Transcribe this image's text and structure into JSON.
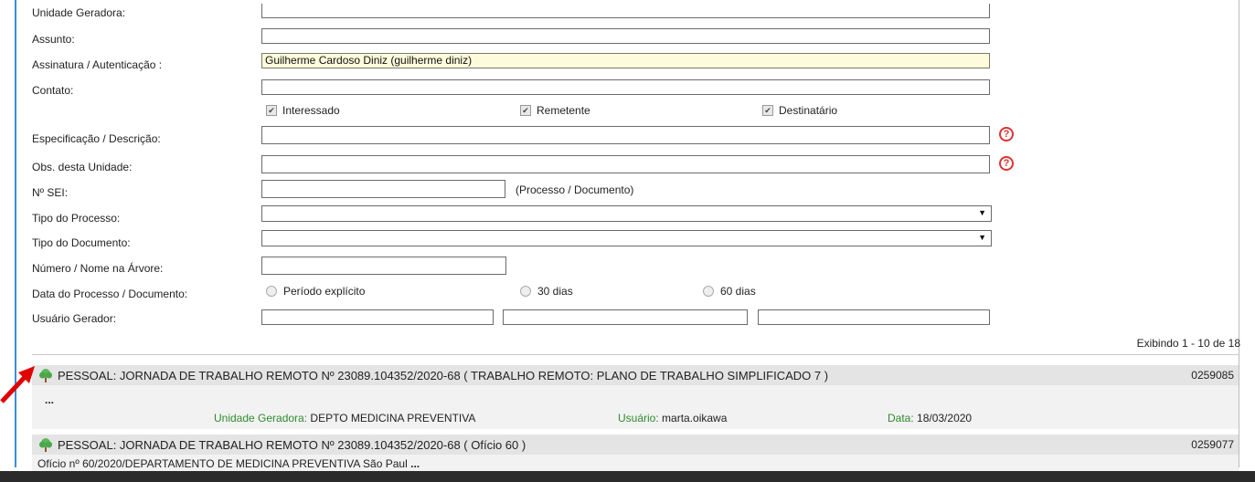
{
  "form": {
    "unidade_geradora_label": "Unidade Geradora:",
    "assunto_label": "Assunto:",
    "assinatura_label": "Assinatura / Autenticação :",
    "assinatura_value": "Guilherme Cardoso Diniz (guilherme diniz)",
    "contato_label": "Contato:",
    "checkbox_interessado": "Interessado",
    "checkbox_remetente": "Remetente",
    "checkbox_destinatario": "Destinatário",
    "especificacao_label": "Especificação / Descrição:",
    "obs_label": "Obs. desta Unidade:",
    "nsei_label": "Nº SEI:",
    "nsei_hint": "(Processo / Documento)",
    "tipo_processo_label": "Tipo do Processo:",
    "tipo_documento_label": "Tipo do Documento:",
    "numero_nome_label": "Número / Nome na Árvore:",
    "data_label": "Data do Processo / Documento:",
    "radio_periodo": "Período explícito",
    "radio_30": "30 dias",
    "radio_60": "60 dias",
    "usuario_gerador_label": "Usuário Gerador:",
    "help_glyph": "?",
    "select_arrow": "▼",
    "check_glyph": "✔"
  },
  "results": {
    "paging": "Exibindo 1 - 10 de 18",
    "items": [
      {
        "title": "PESSOAL: JORNADA DE TRABALHO REMOTO Nº 23089.104352/2020-68 ( TRABALHO REMOTO: PLANO DE TRABALHO SIMPLIFICADO 7 )",
        "number": "0259085",
        "snippet": "...",
        "unidade_label": "Unidade Geradora:",
        "unidade_value": "DEPTO MEDICINA PREVENTIVA",
        "usuario_label": "Usuário:",
        "usuario_value": "marta.oikawa",
        "data_label": "Data:",
        "data_value": "18/03/2020"
      },
      {
        "title": "PESSOAL: JORNADA DE TRABALHO REMOTO Nº 23089.104352/2020-68 ( Ofício 60 )",
        "number": "0259077",
        "snippet": "Ofício nº 60/2020/DEPARTAMENTO DE MEDICINA PREVENTIVA São Paul",
        "snippet_more": "..."
      }
    ]
  },
  "icons": {
    "tree": "tree-icon",
    "help": "help-icon",
    "arrow": "red-arrow-icon"
  },
  "colors": {
    "accent_blue": "#3d8fd0",
    "help_red": "#dd3333",
    "meta_green": "#2e8b2e",
    "result_header": "#e4e4e4"
  }
}
